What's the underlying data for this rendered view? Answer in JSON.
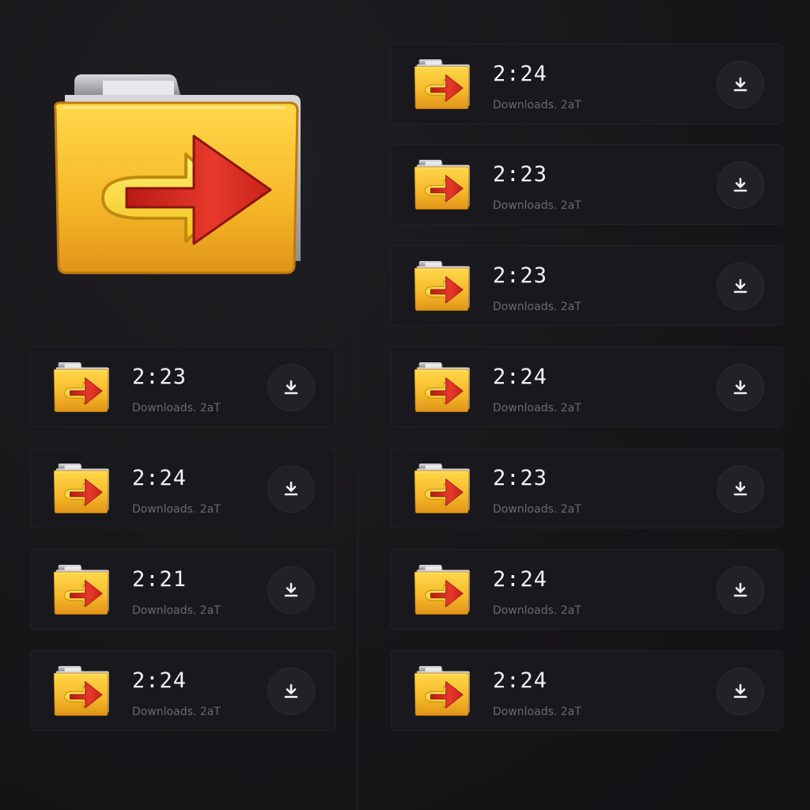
{
  "colors": {
    "background": "#161518",
    "card": "#19181c",
    "folder_yellow": "#f5c426",
    "arrow_red": "#d9261c",
    "text_primary": "#f2f2f2",
    "text_secondary": "#6a696e"
  },
  "hero": {
    "icon": "folder-redirect-icon"
  },
  "left_list": [
    {
      "time": "2:23",
      "subtitle": "Downloads. 2aT",
      "icon": "folder-redirect-icon",
      "action_icon": "download-icon"
    },
    {
      "time": "2:24",
      "subtitle": "Downloads. 2aT",
      "icon": "folder-redirect-icon",
      "action_icon": "download-icon"
    },
    {
      "time": "2:21",
      "subtitle": "Downloads. 2aT",
      "icon": "folder-redirect-icon",
      "action_icon": "download-icon"
    },
    {
      "time": "2:24",
      "subtitle": "Downloads. 2aT",
      "icon": "folder-redirect-icon",
      "action_icon": "download-icon"
    }
  ],
  "right_list": [
    {
      "time": "2:24",
      "subtitle": "Downloads. 2aT",
      "icon": "folder-redirect-icon",
      "action_icon": "download-icon"
    },
    {
      "time": "2:23",
      "subtitle": "Downloads. 2aT",
      "icon": "folder-redirect-icon",
      "action_icon": "download-icon"
    },
    {
      "time": "2:23",
      "subtitle": "Downloads. 2aT",
      "icon": "folder-redirect-icon",
      "action_icon": "download-icon"
    },
    {
      "time": "2:24",
      "subtitle": "Downloads. 2aT",
      "icon": "folder-redirect-icon",
      "action_icon": "download-icon"
    },
    {
      "time": "2:23",
      "subtitle": "Downloads. 2aT",
      "icon": "folder-redirect-icon",
      "action_icon": "download-icon"
    },
    {
      "time": "2:24",
      "subtitle": "Downloads. 2aT",
      "icon": "folder-redirect-icon",
      "action_icon": "download-icon"
    },
    {
      "time": "2:24",
      "subtitle": "Downloads. 2aT",
      "icon": "folder-redirect-icon",
      "action_icon": "download-icon"
    }
  ]
}
